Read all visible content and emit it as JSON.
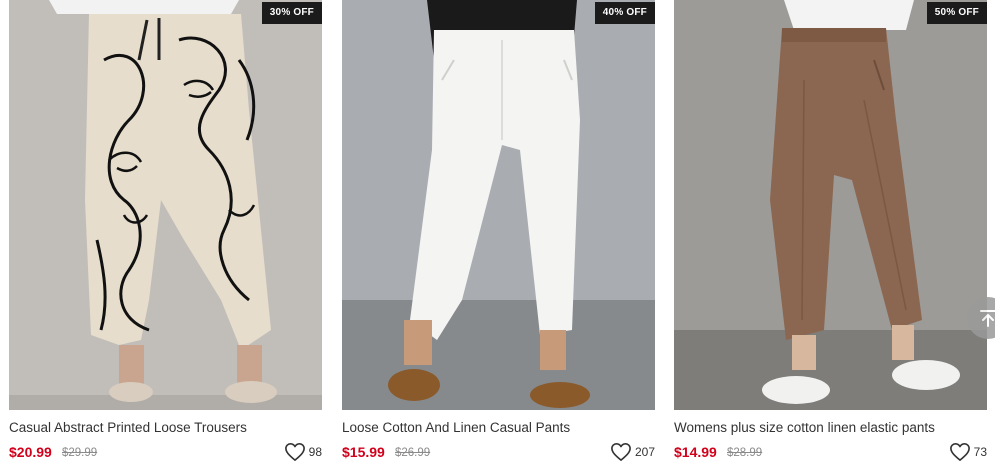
{
  "products": [
    {
      "discount": "30% OFF",
      "title": "Casual Abstract Printed Loose Trousers",
      "price": "$20.99",
      "original_price": "$29.99",
      "likes": "98"
    },
    {
      "discount": "40% OFF",
      "title": "Loose Cotton And Linen Casual Pants",
      "price": "$15.99",
      "original_price": "$26.99",
      "likes": "207"
    },
    {
      "discount": "50% OFF",
      "title": "Womens plus size cotton linen elastic pants",
      "price": "$14.99",
      "original_price": "$28.99",
      "likes": "73"
    }
  ],
  "icons": {
    "like": "heart-outline-icon",
    "back_to_top": "arrow-up-to-top-icon"
  },
  "colors": {
    "sale_price": "#d0021b",
    "badge_bg": "#1b1b1b",
    "original_price": "#8a8a8a"
  }
}
